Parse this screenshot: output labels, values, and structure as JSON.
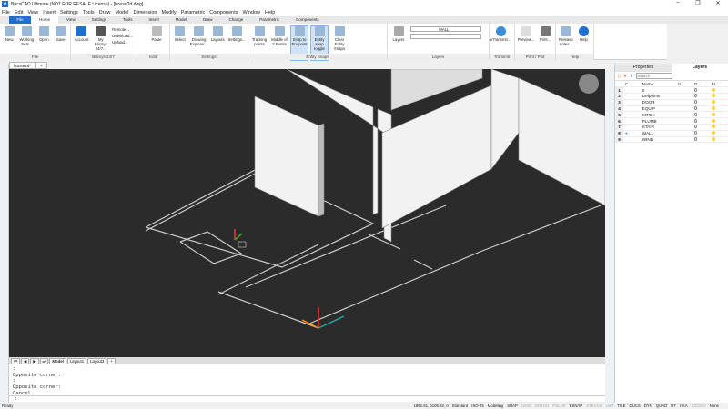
{
  "title": "BricsCAD Ultimate (NOT FOR RESALE License) - [house2d.dwg]",
  "menu": [
    "File",
    "Edit",
    "View",
    "Insert",
    "Settings",
    "Tools",
    "Draw",
    "Model",
    "Dimension",
    "Modify",
    "Parametric",
    "Components",
    "Window",
    "Help"
  ],
  "ribbon_tabs": [
    "File",
    "Home",
    "View",
    "Settings",
    "Tools",
    "Insert",
    "Model",
    "Draw",
    "Change",
    "Parametric",
    "Components"
  ],
  "groups": {
    "file": {
      "label": "File",
      "buttons": [
        "New",
        "Working Sets...",
        "Open",
        "Save"
      ]
    },
    "bricsys": {
      "label": "Bricsys 24/7",
      "buttons": [
        "Account",
        "My Bricsys 24/7..."
      ],
      "small": [
        "Remote...",
        "Download...",
        "Upload..."
      ]
    },
    "edit": {
      "label": "Edit",
      "buttons": [
        "Paste"
      ]
    },
    "settings": {
      "label": "Settings",
      "buttons": [
        "Select",
        "Drawing Explorer...",
        "Layouts",
        "Settings..."
      ]
    },
    "snaps": {
      "label": "Entity Snaps",
      "buttons": [
        "Tracking points",
        "Middle of 2 Points",
        "Snap to Endpoint",
        "Entity snap toggle",
        "Clear Entity Snaps"
      ]
    },
    "layers": {
      "label": "Layers",
      "buttons": [
        "Layers"
      ],
      "current_layer": "WALL"
    },
    "transmit": {
      "label": "Transmit",
      "buttons": [
        "eTransmit..."
      ]
    },
    "print": {
      "label": "Print / Plot",
      "buttons": [
        "Preview...",
        "Print..."
      ]
    },
    "help": {
      "label": "Help",
      "buttons": [
        "Release notes...",
        "Help"
      ]
    }
  },
  "doc_tab": "house2d*",
  "layout_tabs": [
    "Model",
    "Layout1",
    "Layout2",
    "+"
  ],
  "command_history": [
    ":",
    "Opposite corner:",
    ":",
    "Opposite corner:",
    "Cancel"
  ],
  "command_prompt": ":",
  "panel": {
    "tabs": [
      "Properties",
      "Layers"
    ],
    "search_placeholder": "Search",
    "columns": [
      "C...",
      "Name",
      "0...",
      "O...",
      "Fr..."
    ],
    "layers": [
      {
        "n": "1",
        "name": "0"
      },
      {
        "n": "2",
        "name": "Defpoints"
      },
      {
        "n": "3",
        "name": "DOOR"
      },
      {
        "n": "4",
        "name": "EQUIP"
      },
      {
        "n": "5",
        "name": "KITCH"
      },
      {
        "n": "6",
        "name": "PLUMB"
      },
      {
        "n": "7",
        "name": "STAIR"
      },
      {
        "n": "8",
        "name": "WALL"
      },
      {
        "n": "9",
        "name": "WIND"
      }
    ]
  },
  "status": {
    "ready": "Ready",
    "coords": "1862.61, 6105.92, 0",
    "items": [
      "Standard",
      "ISO-25",
      "Modeling",
      "SNAP",
      "GRID",
      "ORTHO",
      "POLAR",
      "ESNAP",
      "STRACK",
      "LWT",
      "TILE",
      "DUCS",
      "DYN",
      "QUAD",
      "RT",
      "HKA",
      "LOCKUI",
      "None"
    ]
  }
}
